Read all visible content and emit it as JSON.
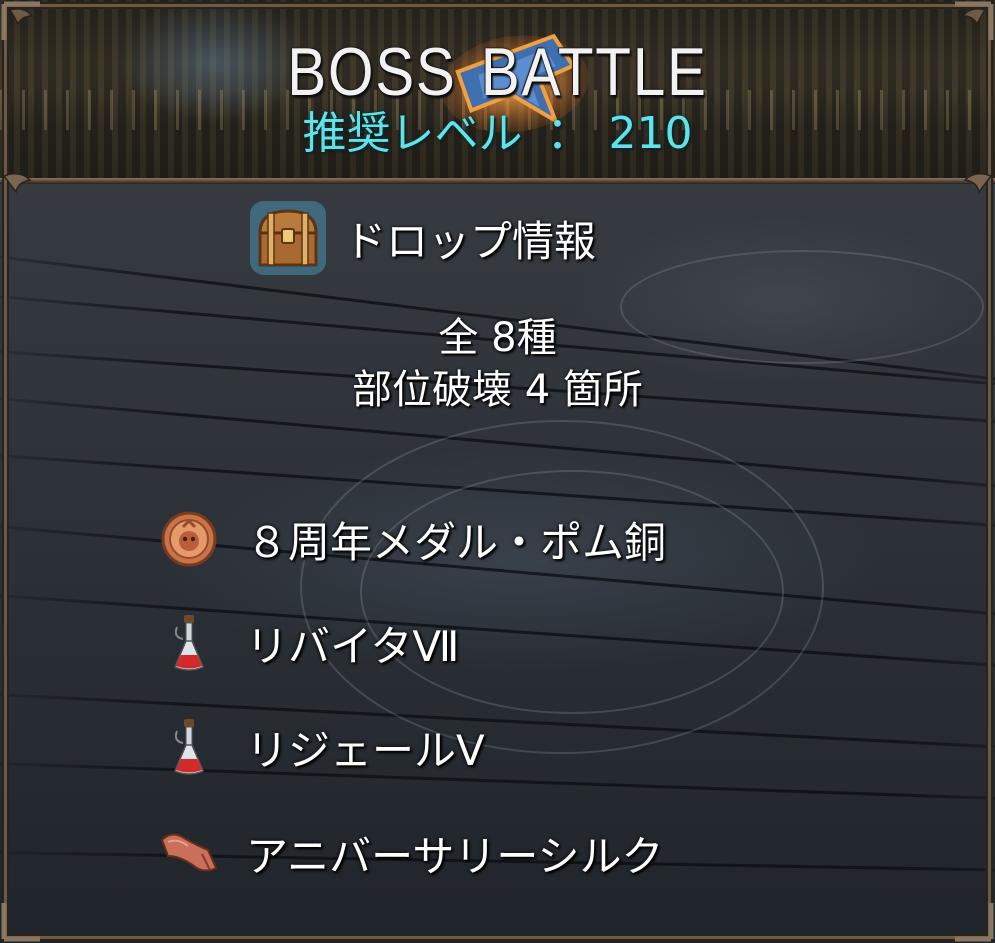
{
  "header": {
    "title_word1": "BOSS",
    "title_word2": "BATTLE",
    "level_label": "推奨レベル",
    "level_separator": "：",
    "level_value": "210"
  },
  "drop": {
    "title": "ドロップ情報",
    "total": "全 8種",
    "part_break": "部位破壊 4 箇所"
  },
  "items": [
    {
      "label": "８周年メダル・ポム銅",
      "icon": "bronze-medal-icon"
    },
    {
      "label": "リバイタⅦ",
      "icon": "potion-flask-icon"
    },
    {
      "label": "リジェールⅤ",
      "icon": "potion-flask-icon"
    },
    {
      "label": "アニバーサリーシルク",
      "icon": "silk-cloth-icon"
    }
  ],
  "colors": {
    "title": "#f2f2f2",
    "level": "#5fe3e8",
    "text": "#ffffff",
    "frame": "#6a5a48"
  }
}
